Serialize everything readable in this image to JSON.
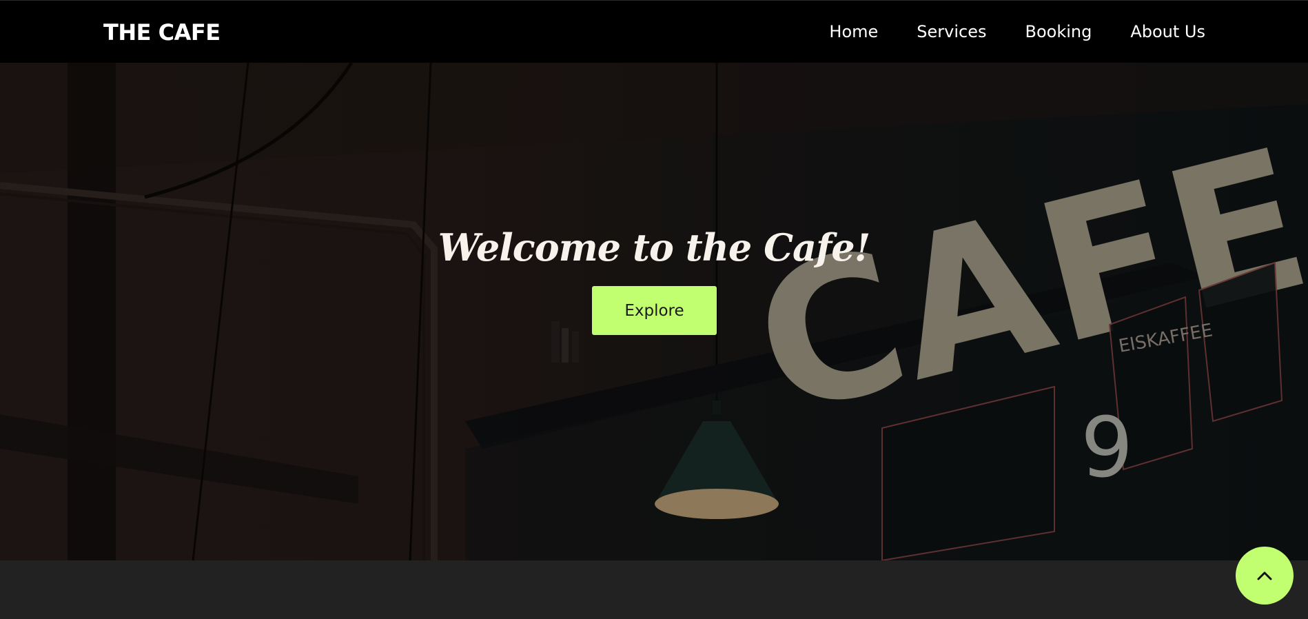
{
  "navbar": {
    "brand": "THE CAFE",
    "links": [
      {
        "label": "Home"
      },
      {
        "label": "Services"
      },
      {
        "label": "Booking"
      },
      {
        "label": "About Us"
      }
    ]
  },
  "hero": {
    "title": "Welcome to the Cafe!",
    "button_label": "Explore",
    "sign_text": "CAFE",
    "menu_board_text": [
      "EISKAFFEE",
      "9"
    ]
  },
  "scroll_top": {
    "icon": "chevron-up-icon"
  },
  "colors": {
    "accent": "#c2ff70",
    "navbar_bg": "#000000",
    "page_bg": "#222222"
  }
}
